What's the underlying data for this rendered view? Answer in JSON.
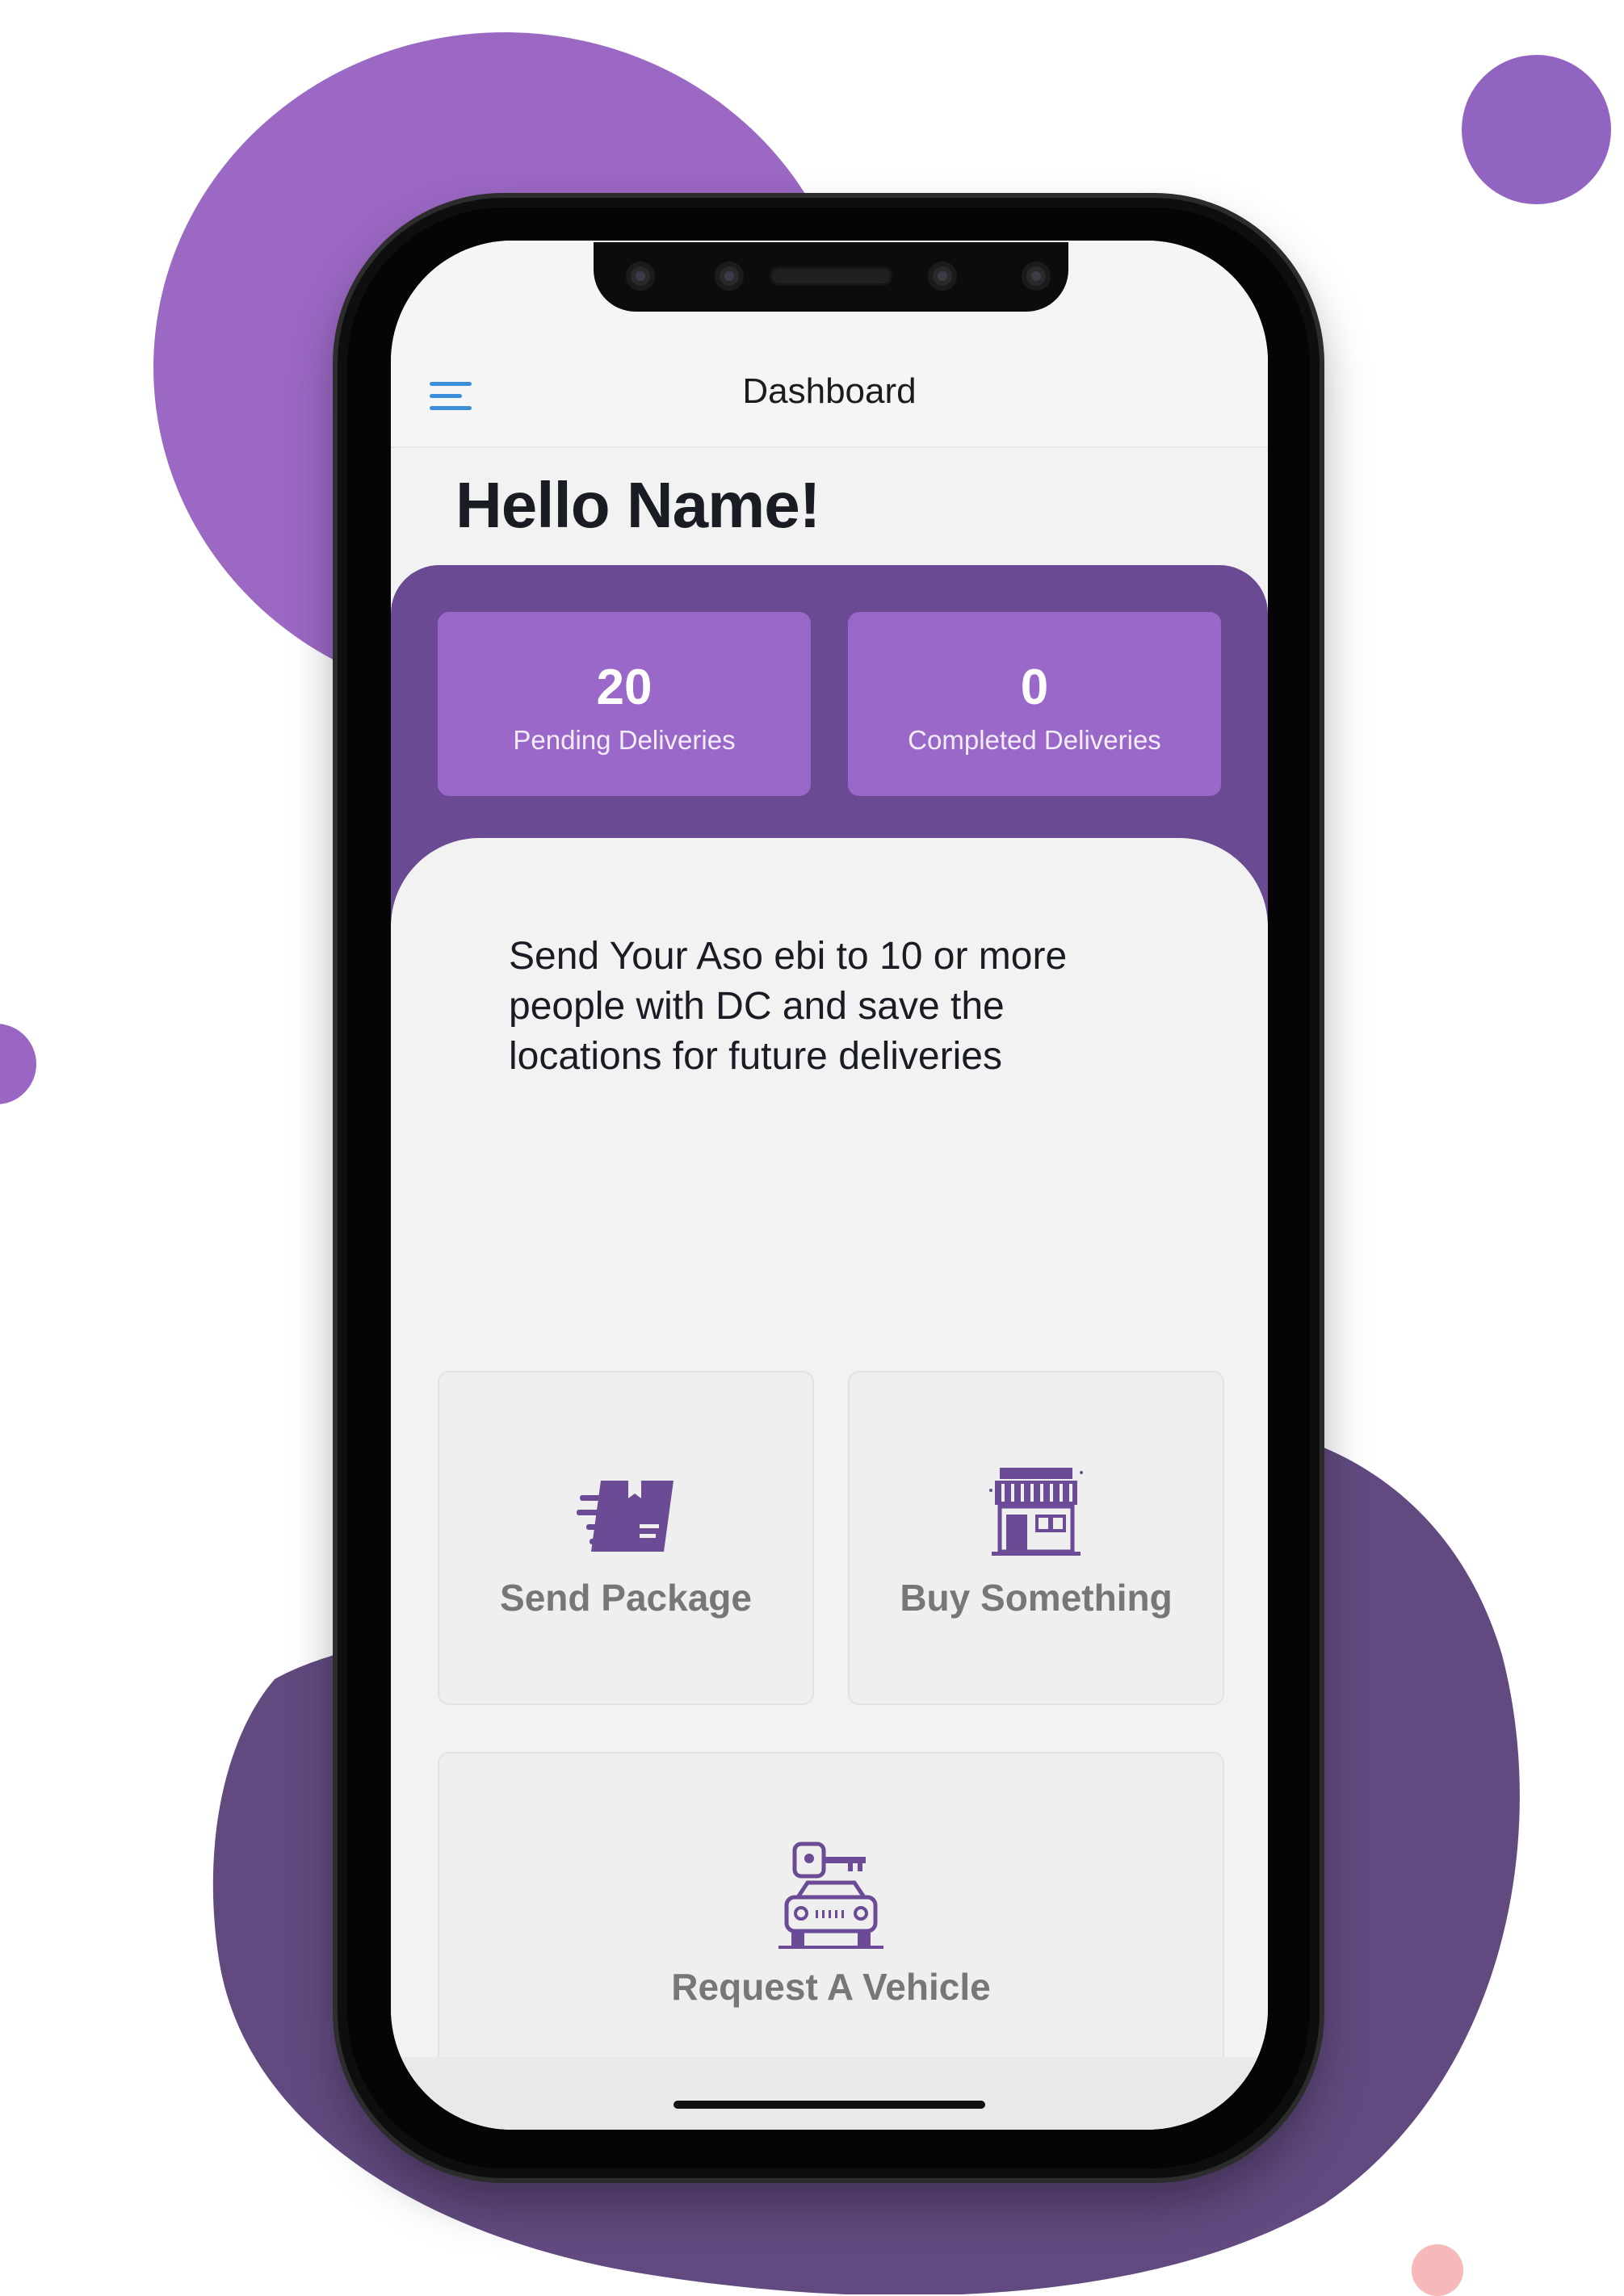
{
  "colors": {
    "accent_purple": "#9a68c8",
    "panel_purple": "#6a4a93",
    "menu_blue": "#3a8fd8",
    "label_gray": "#777777"
  },
  "nav": {
    "title": "Dashboard",
    "menu_icon": "hamburger-menu-icon"
  },
  "greeting": "Hello Name!",
  "stats": [
    {
      "value": "20",
      "label": "Pending Deliveries"
    },
    {
      "value": "0",
      "label": "Completed Deliveries"
    }
  ],
  "promo": {
    "line1": "Send Your Aso ebi to 10 or more",
    "line2": "people with DC and save the",
    "line3": "locations for future deliveries"
  },
  "actions": [
    {
      "label": "Send Package",
      "icon": "package-icon"
    },
    {
      "label": "Buy Something",
      "icon": "store-icon"
    },
    {
      "label": "Request A Vehicle",
      "icon": "car-key-icon"
    }
  ]
}
